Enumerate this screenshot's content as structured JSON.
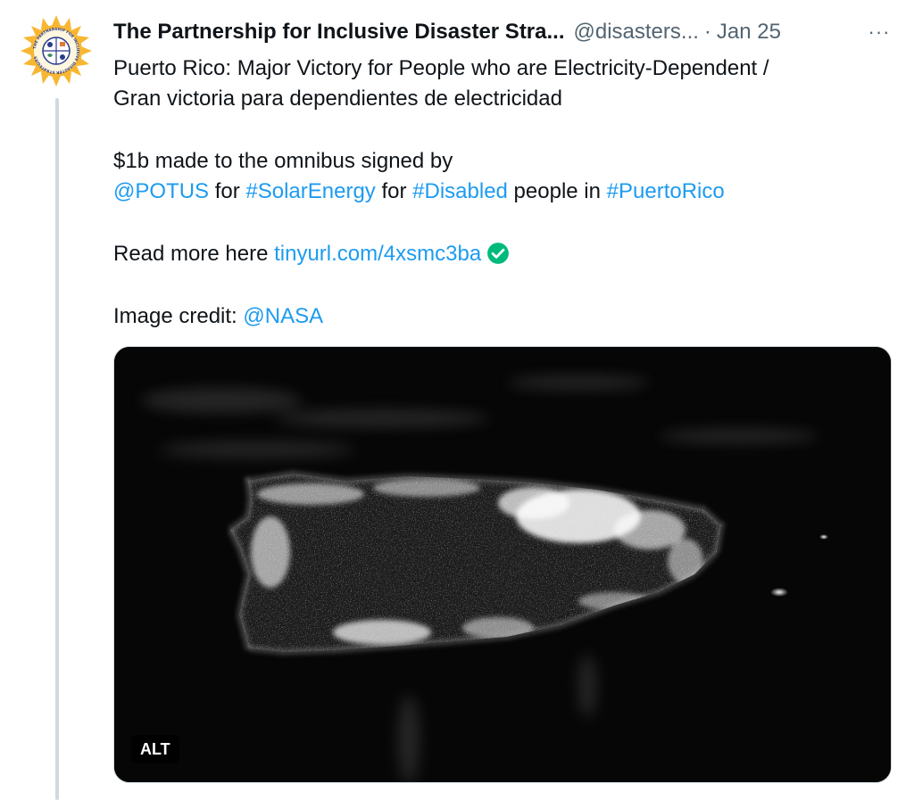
{
  "tweet": {
    "author_name": "The Partnership for Inclusive Disaster Stra...",
    "handle": "@disasters...",
    "separator": "·",
    "date": "Jan 25",
    "more_label": "···",
    "avatar_ring_text": "THE PARTNERSHIP FOR INCLUSIVE DISASTER STRATEGIES",
    "line1": "Puerto Rico: Major Victory for People who are Electricity-Dependent /",
    "line2": "Gran victoria para dependientes de electricidad",
    "para2_text": "$1b made to the omnibus signed by",
    "mention_potus": "@POTUS",
    "word_for_1": " for ",
    "hashtag_solar": "#SolarEnergy",
    "word_for_2": " for ",
    "hashtag_disabled": "#Disabled",
    "word_people_in": " people in ",
    "hashtag_pr": "#PuertoRico",
    "read_more_text": "Read more here ",
    "link_url": "tinyurl.com/4xsmc3ba",
    "credit_text": "Image credit: ",
    "mention_nasa": "@NASA",
    "media_alt_label": "ALT"
  },
  "colors": {
    "link": "#1d9bf0",
    "muted": "#536471",
    "text": "#0f1419",
    "check_green": "#00ba7c",
    "avatar_sun": "#f7b733"
  },
  "icons": {
    "avatar": "organization-logo",
    "check": "check-circle-icon",
    "more": "more-horizontal-icon"
  }
}
